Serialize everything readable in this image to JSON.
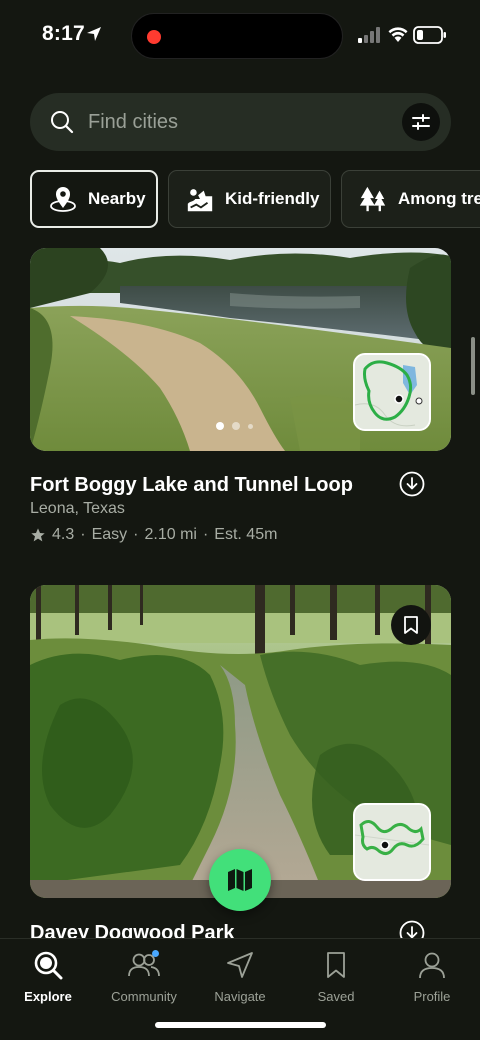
{
  "status_bar": {
    "time": "8:17"
  },
  "search": {
    "placeholder": "Find cities"
  },
  "chips": [
    {
      "label": "Nearby",
      "icon": "nearby-pin-icon",
      "active": true
    },
    {
      "label": "Kid-friendly",
      "icon": "kid-friendly-icon",
      "active": false
    },
    {
      "label": "Among trees",
      "icon": "trees-icon",
      "active": false
    }
  ],
  "trails": [
    {
      "name": "Fort Boggy Lake and Tunnel Loop",
      "location": "Leona, Texas",
      "rating": "4.3",
      "difficulty": "Easy",
      "distance": "2.10 mi",
      "est_time": "Est. 45m"
    },
    {
      "name": "Davey Dogwood Park"
    }
  ],
  "tabs": [
    {
      "label": "Explore",
      "active": true
    },
    {
      "label": "Community",
      "active": false
    },
    {
      "label": "Navigate",
      "active": false
    },
    {
      "label": "Saved",
      "active": false
    },
    {
      "label": "Profile",
      "active": false
    }
  ],
  "colors": {
    "accent_green": "#42e07a",
    "background": "#141711",
    "notification_blue": "#4aa8ff"
  }
}
